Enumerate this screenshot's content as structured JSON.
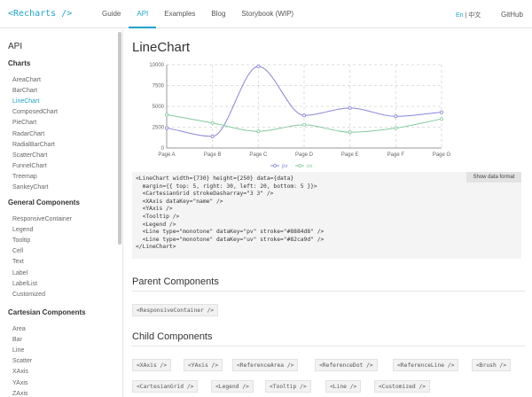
{
  "header": {
    "logo": "<Recharts />",
    "nav": [
      "Guide",
      "API",
      "Examples",
      "Blog",
      "Storybook (WIP)"
    ],
    "active_nav": 1,
    "lang_en": "En",
    "lang_sep": " | ",
    "lang_zh": "中文",
    "github": "GitHub"
  },
  "sidebar": {
    "title": "API",
    "categories": [
      {
        "label": "Charts",
        "items": [
          "AreaChart",
          "BarChart",
          "LineChart",
          "ComposedChart",
          "PieChart",
          "RadarChart",
          "RadialBarChart",
          "ScatterChart",
          "FunnelChart",
          "Treemap",
          "SankeyChart"
        ]
      },
      {
        "label": "General Components",
        "items": [
          "ResponsiveContainer",
          "Legend",
          "Tooltip",
          "Cell",
          "Text",
          "Label",
          "LabelList",
          "Customized"
        ]
      },
      {
        "label": "Cartesian Components",
        "items": [
          "Area",
          "Bar",
          "Line",
          "Scatter",
          "XAxis",
          "YAxis",
          "ZAxis"
        ]
      }
    ],
    "active_item": "LineChart"
  },
  "main": {
    "title": "LineChart",
    "show_data_button": "Show data format",
    "code_lines": [
      "<LineChart width={730} height={250} data={data}",
      "  margin={{ top: 5, right: 30, left: 20, bottom: 5 }}>",
      "  <CartesianGrid strokeDasharray=\"3 3\" />",
      "  <XAxis dataKey=\"name\" />",
      "  <YAxis />",
      "  <Tooltip />",
      "  <Legend />",
      "  <Line type=\"monotone\" dataKey=\"pv\" stroke=\"#8884d8\" />",
      "  <Line type=\"monotone\" dataKey=\"uv\" stroke=\"#82ca9d\" />",
      "</LineChart>"
    ],
    "parent_title": "Parent Components",
    "parent_chips": [
      "<ResponsiveContainer />"
    ],
    "child_title": "Child Components",
    "child_chips": [
      "<XAxis />",
      "<YAxis />",
      "<ReferenceArea />",
      "<ReferenceDot />",
      "<ReferenceLine />",
      "<Brush />",
      "<CartesianGrid />",
      "<Legend />",
      "<Tooltip />",
      "<Line />",
      "<Customized />"
    ]
  },
  "colors": {
    "accent": "#22a3c9",
    "pv": "#8884d8",
    "uv": "#82ca9d"
  },
  "chart_data": {
    "type": "line",
    "categories": [
      "Page A",
      "Page B",
      "Page C",
      "Page D",
      "Page E",
      "Page F",
      "Page G"
    ],
    "series": [
      {
        "name": "pv",
        "color": "#8884d8",
        "values": [
          2400,
          1398,
          9800,
          3908,
          4800,
          3800,
          4300
        ]
      },
      {
        "name": "uv",
        "color": "#82ca9d",
        "values": [
          4000,
          3000,
          2000,
          2780,
          1890,
          2390,
          3490
        ]
      }
    ],
    "yticks": [
      "0",
      "2500",
      "5000",
      "7500",
      "10000"
    ],
    "ylim": [
      0,
      10000
    ],
    "grid": true,
    "legend": "bottom-center"
  }
}
